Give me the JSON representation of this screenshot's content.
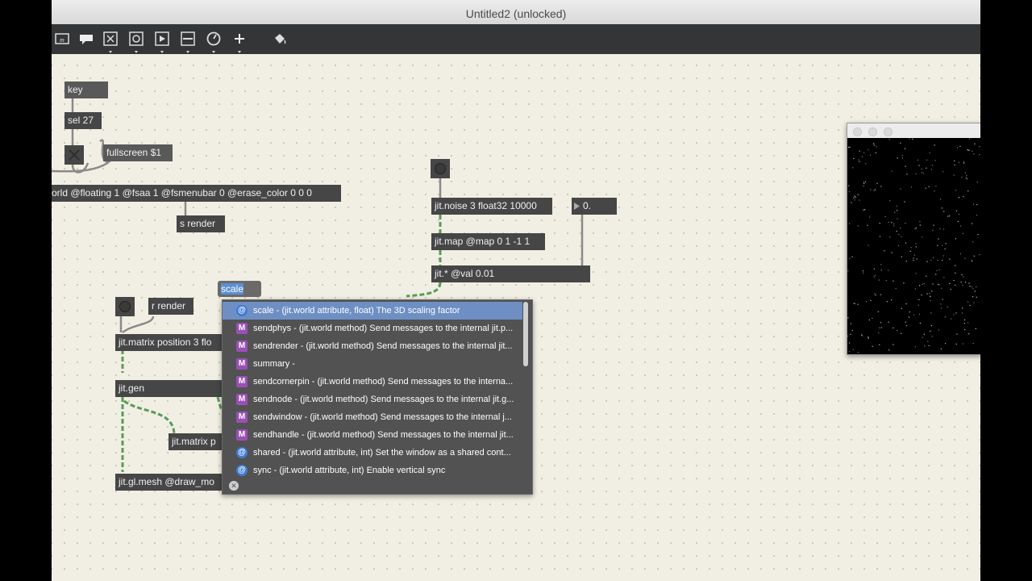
{
  "window": {
    "title": "Untitled2 (unlocked)",
    "prev_title_fragment": "…"
  },
  "toolbar": {
    "icons": [
      "message-icon",
      "comment-icon",
      "button-x-icon",
      "toggle-icon",
      "play-icon",
      "slider-icon",
      "dial-icon",
      "plus-icon",
      "paint-bucket-icon"
    ]
  },
  "objects": {
    "key": "key",
    "sel27": "sel 27",
    "fullscreen": "fullscreen $1",
    "jitworld": "orld @floating 1 @fsaa 1 @fsmenubar 0 @erase_color 0 0 0",
    "s_render": "s render",
    "r_render": "r render",
    "jit_matrix_pos": "jit.matrix position 3 flo",
    "jit_gen": "jit.gen",
    "jit_matrix_p": "jit.matrix p",
    "jit_gl_mesh": "jit.gl.mesh @draw_mo",
    "jit_noise": "jit.noise 3 float32 10000",
    "jit_map": "jit.map @map 0 1 -1 1",
    "jit_mult": "jit.* @val 0.01",
    "flonum": "0."
  },
  "autocomplete": {
    "typed": "scale",
    "items": [
      {
        "kind": "@",
        "text": "scale - (jit.world attribute, float) The 3D scaling factor",
        "selected": true
      },
      {
        "kind": "M",
        "text": "sendphys - (jit.world method) Send messages to the internal jit.p..."
      },
      {
        "kind": "M",
        "text": "sendrender - (jit.world method) Send messages to the internal jit..."
      },
      {
        "kind": "M",
        "text": "summary -"
      },
      {
        "kind": "M",
        "text": "sendcornerpin - (jit.world method) Send messages to the interna..."
      },
      {
        "kind": "M",
        "text": "sendnode - (jit.world method) Send messages to the internal jit.g..."
      },
      {
        "kind": "M",
        "text": "sendwindow - (jit.world method) Send messages to the internal j..."
      },
      {
        "kind": "M",
        "text": "sendhandle - (jit.world method) Send messages to the internal jit..."
      },
      {
        "kind": "@",
        "text": "shared - (jit.world attribute, int) Set the window as a shared cont..."
      },
      {
        "kind": "@",
        "text": "sync - (jit.world attribute, int) Enable vertical sync"
      }
    ]
  },
  "colors": {
    "selection": "#6e8fc4",
    "attr_badge": "#3f7bd4",
    "method_badge": "#9b4fb6",
    "patch_cord": "#5a9a5a"
  }
}
